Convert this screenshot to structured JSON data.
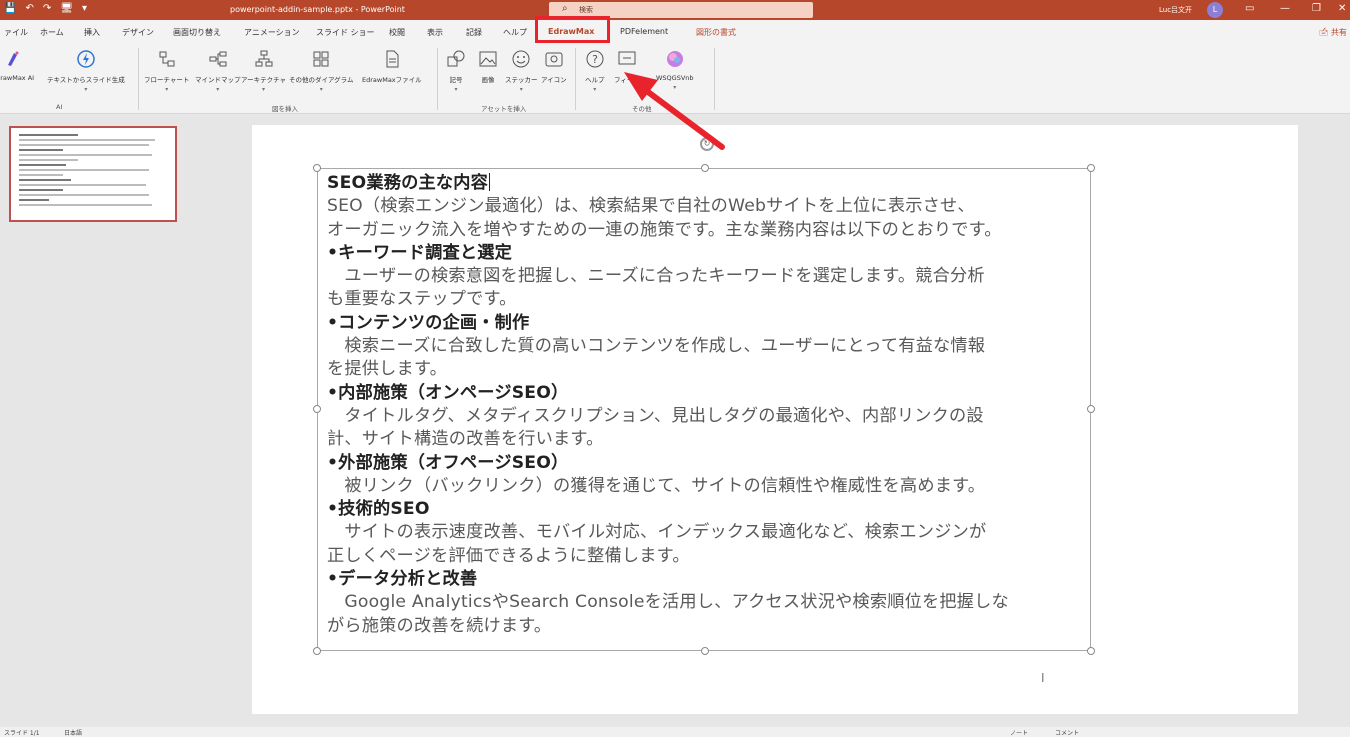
{
  "title_bar": {
    "quick_access": [
      "💾",
      "↶",
      "↷",
      "🖥",
      "▾"
    ],
    "document_title": "powerpoint-addin-sample.pptx  -  PowerPoint",
    "search_placeholder": "検索",
    "user_name": "Luc吕文开",
    "avatar_initial": "L",
    "window_controls": [
      "▭",
      "—",
      "❐",
      "✕"
    ]
  },
  "menu": {
    "tabs": [
      "ァイル",
      "ホーム",
      "挿入",
      "デザイン",
      "画面切り替え",
      "アニメーション",
      "スライド ショー",
      "校閲",
      "表示",
      "記録",
      "ヘルプ",
      "EdrawMax",
      "PDFelement",
      "図形の書式"
    ],
    "active_tab": "EdrawMax",
    "share_label": "🖆 共有"
  },
  "ribbon": {
    "groups": [
      {
        "label": "AI",
        "buttons": [
          "EdrawMax AI",
          "テキストからスライド生成"
        ]
      },
      {
        "label": "図を挿入",
        "buttons": [
          "フローチャート",
          "マインドマップ",
          "アーキテクチャ",
          "その他のダイアグラム",
          "EdrawMaxファイル"
        ]
      },
      {
        "label": "アセットを挿入",
        "buttons": [
          "記号",
          "画像",
          "ステッカー",
          "アイコン"
        ]
      },
      {
        "label": "その他",
        "buttons": [
          "ヘルプ",
          "フィード",
          "WSQGSVnb"
        ]
      }
    ],
    "colors": {
      "accent": "#b7472a",
      "ai_icon": "#5b4fd6",
      "highlight": "#e8232b"
    }
  },
  "slide": {
    "title": "SEO業務の主な内容",
    "lines": [
      {
        "type": "body",
        "text": "SEO（検索エンジン最適化）は、検索結果で自社のWebサイトを上位に表示させ、"
      },
      {
        "type": "body",
        "text": "オーガニック流入を増やすための一連の施策です。主な業務内容は以下のとおりです。"
      },
      {
        "type": "heading",
        "text": "•キーワード調査と選定"
      },
      {
        "type": "body",
        "text": "　ユーザーの検索意図を把握し、ニーズに合ったキーワードを選定します。競合分析"
      },
      {
        "type": "body",
        "text": "も重要なステップです。"
      },
      {
        "type": "heading",
        "text": "•コンテンツの企画・制作"
      },
      {
        "type": "body",
        "text": "　検索ニーズに合致した質の高いコンテンツを作成し、ユーザーにとって有益な情報"
      },
      {
        "type": "body",
        "text": "を提供します。"
      },
      {
        "type": "heading",
        "text": "•内部施策（オンページSEO）"
      },
      {
        "type": "body",
        "text": "　タイトルタグ、メタディスクリプション、見出しタグの最適化や、内部リンクの設"
      },
      {
        "type": "body",
        "text": "計、サイト構造の改善を行います。"
      },
      {
        "type": "heading",
        "text": "•外部施策（オフページSEO）"
      },
      {
        "type": "body",
        "text": "　被リンク（バックリンク）の獲得を通じて、サイトの信頼性や権威性を高めます。"
      },
      {
        "type": "heading",
        "text": "•技術的SEO"
      },
      {
        "type": "body",
        "text": "　サイトの表示速度改善、モバイル対応、インデックス最適化など、検索エンジンが"
      },
      {
        "type": "body",
        "text": "正しくページを評価できるように整備します。"
      },
      {
        "type": "heading",
        "text": "•データ分析と改善"
      },
      {
        "type": "body",
        "text": "　Google AnalyticsやSearch Consoleを活用し、アクセス状況や検索順位を把握しな"
      },
      {
        "type": "body",
        "text": "がら施策の改善を続けます。"
      }
    ]
  },
  "status_bar": {
    "left": [
      "スライド 1/1",
      "日本語"
    ],
    "right": [
      "ノート",
      "コメント"
    ]
  }
}
